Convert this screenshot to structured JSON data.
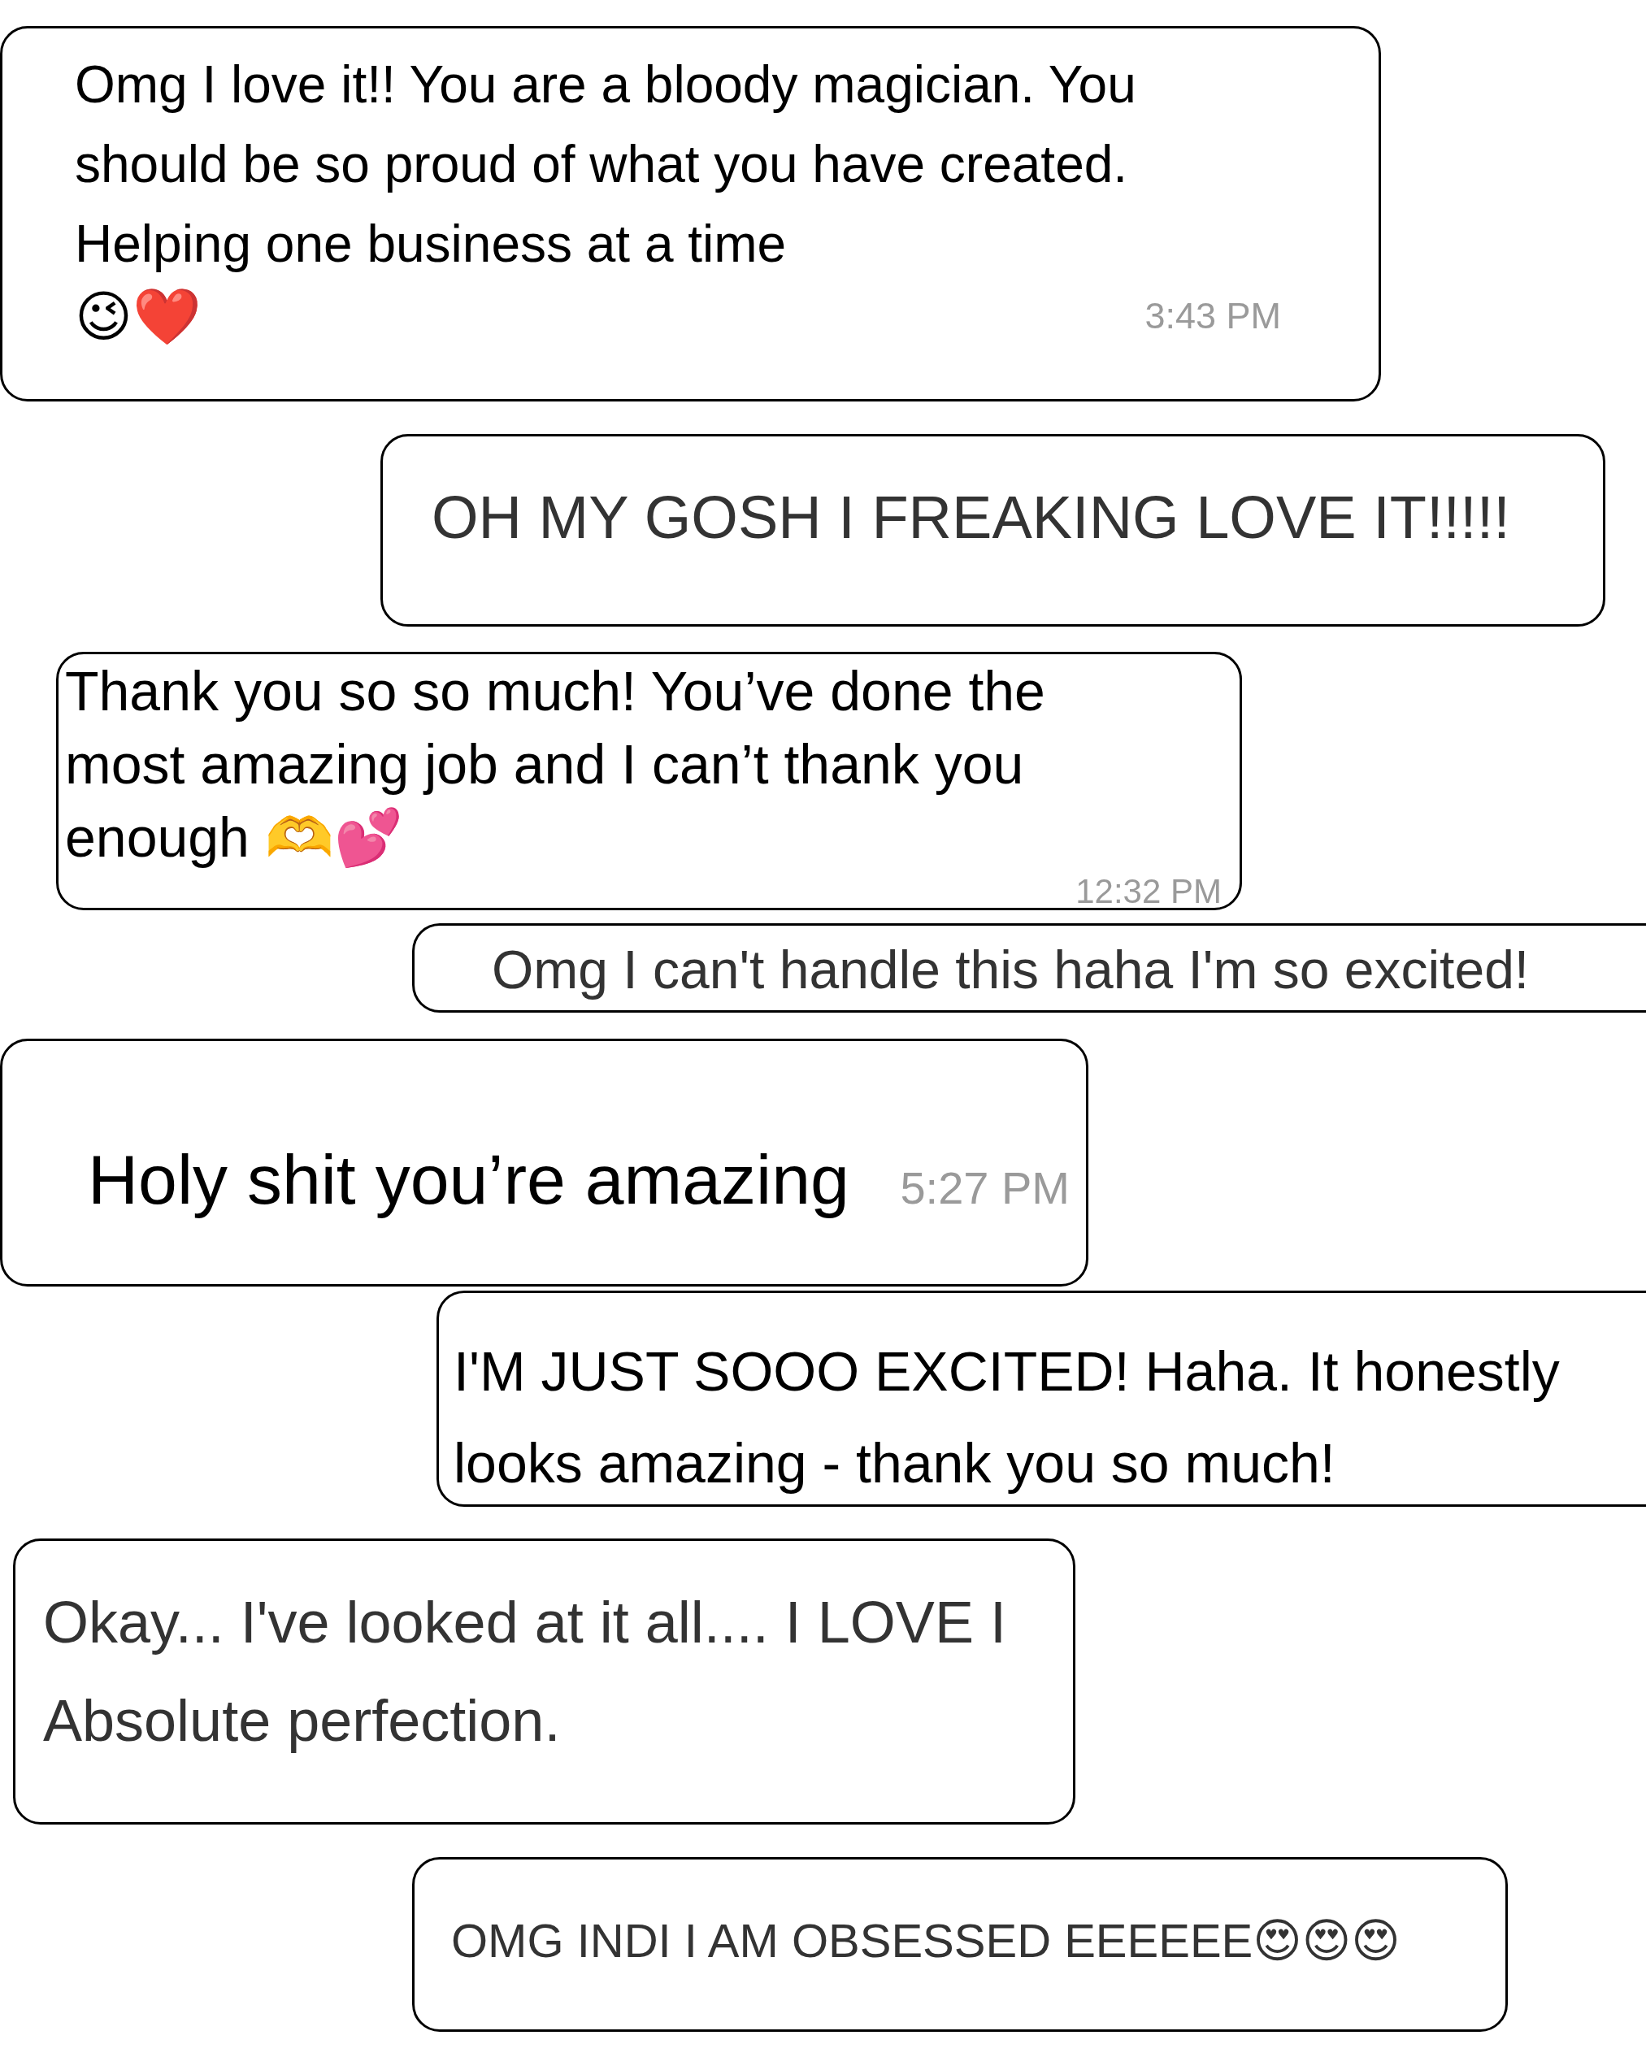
{
  "messages": [
    {
      "text": "Omg I love it!! You are a bloody magician. You should be so proud of what you have created. Helping one business at a time",
      "emoji": "😉❤️",
      "time": "3:43 PM"
    },
    {
      "text": "OH MY GOSH I FREAKING LOVE IT!!!!!"
    },
    {
      "text": "Thank you so so much! You’ve done the most amazing job and I can’t thank you enough 🫶💕",
      "time": "12:32 PM"
    },
    {
      "text": "Omg I can't handle this haha I'm so excited!"
    },
    {
      "text": "Holy shit you’re amazing",
      "time": "5:27 PM"
    },
    {
      "text": "I'M JUST SOOO EXCITED! Haha. It honestly looks amazing - thank you so much!"
    },
    {
      "text": "Okay... I've looked at it all.... I LOVE I Absolute perfection."
    },
    {
      "text": "OMG INDI I AM OBSESSED EEEEEE😍😍😍"
    }
  ]
}
